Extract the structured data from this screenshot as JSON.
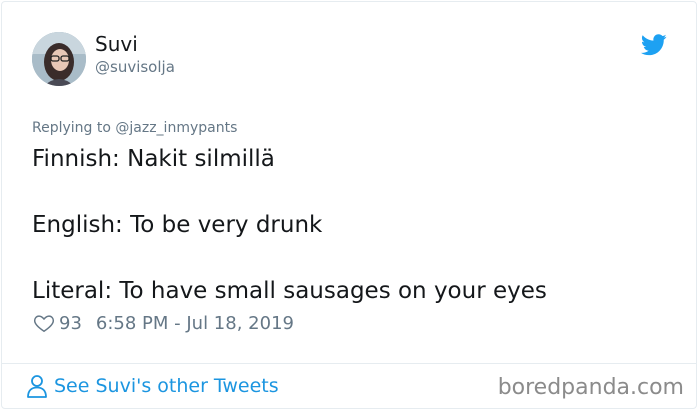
{
  "author": {
    "display_name": "Suvi",
    "handle": "@suvisolja"
  },
  "reply": {
    "prefix": "Replying to ",
    "to_handle": "@jazz_inmypants"
  },
  "tweet": {
    "lines": [
      "Finnish: Nakit silmillä",
      "English: To be very drunk",
      "Literal: To have small sausages on your eyes"
    ]
  },
  "meta": {
    "likes": "93",
    "timestamp": "6:58 PM - Jul 18, 2019"
  },
  "footer": {
    "see_more_label": "See Suvi's other Tweets",
    "watermark": "boredpanda.com"
  },
  "icons": {
    "brand": "twitter-bird-icon",
    "like": "heart-icon",
    "profile": "person-icon"
  },
  "colors": {
    "accent": "#1da1f2",
    "link": "#1b95e0",
    "muted": "#657786",
    "text": "#14171a"
  }
}
